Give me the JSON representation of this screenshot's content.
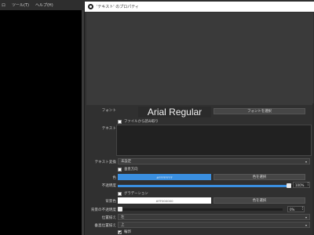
{
  "main_window": {
    "menu": [
      "ロ",
      "ツール(T)",
      "ヘルプ(H)"
    ]
  },
  "dialog": {
    "title": "'テキスト' のプロパティ",
    "font": {
      "label": "フォント",
      "display": "Arial Regular",
      "select_button": "フォントを選択"
    },
    "read_from_file": {
      "label": "ファイルから読み取り",
      "checked": false
    },
    "text": {
      "label": "テキスト",
      "value": ""
    },
    "text_transform": {
      "label": "テキスト変換",
      "value": "未設定"
    },
    "vertical": {
      "label": "垂直方向",
      "checked": false
    },
    "color": {
      "label": "色",
      "hex": "#FFFFFFFF",
      "swatch_color": "#3a8fe0",
      "select_button": "色を選択"
    },
    "opacity": {
      "label": "不透明度",
      "value": "100%",
      "fraction": 1.0
    },
    "gradient": {
      "label": "グラデーション",
      "checked": false
    },
    "bg_color": {
      "label": "背景色",
      "hex": "#FF000000",
      "swatch_color": "#ffffff",
      "select_button": "色を選択"
    },
    "bg_opacity": {
      "label": "背景の不透明度",
      "value": "0%",
      "fraction": 0.0
    },
    "align": {
      "label": "位置揃え",
      "value": "左"
    },
    "valign": {
      "label": "垂直位置揃え",
      "value": "上"
    },
    "outline": {
      "label": "輪郭",
      "checked": true
    }
  }
}
